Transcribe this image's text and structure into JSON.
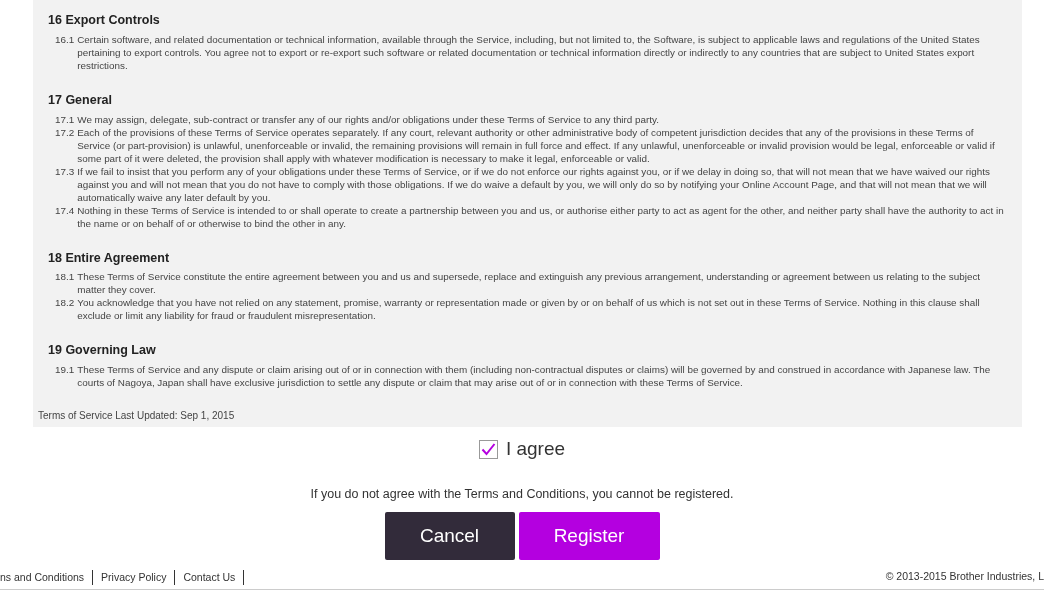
{
  "sections": [
    {
      "heading": "16 Export Controls",
      "clauses": [
        {
          "number": "16.1",
          "text": "Certain software, and related documentation or technical information, available through the Service, including, but not limited to, the Software, is subject to applicable laws and regulations of the United States pertaining to export controls. You agree not to export or re-export such software or related documentation or technical information directly or indirectly to any countries that are subject to United States export restrictions."
        }
      ]
    },
    {
      "heading": "17 General",
      "clauses": [
        {
          "number": "17.1",
          "text": "We may assign, delegate, sub-contract or transfer any of our rights and/or obligations under these Terms of Service to any third party."
        },
        {
          "number": "17.2",
          "text": "Each of the provisions of these Terms of Service operates separately. If any court, relevant authority or other administrative body of competent jurisdiction decides that any of the provisions in these Terms of Service (or part-provision) is unlawful, unenforceable or invalid, the remaining provisions will remain in full force and effect. If any unlawful, unenforceable or invalid provision would be legal, enforceable or valid if some part of it were deleted, the provision shall apply with whatever modification is necessary to make it legal, enforceable or valid."
        },
        {
          "number": "17.3",
          "text": "If we fail to insist that you perform any of your obligations under these Terms of Service, or if we do not enforce our rights against you, or if we delay in doing so, that will not mean that we have waived our rights against you and will not mean that you do not have to comply with those obligations. If we do waive a default by you, we will only do so by notifying your Online Account Page, and that will not mean that we will automatically waive any later default by you."
        },
        {
          "number": "17.4",
          "text": "Nothing in these Terms of Service is intended to or shall operate to create a partnership between you and us, or authorise either party to act as agent for the other, and neither party shall have the authority to act in the name or on behalf of or otherwise to bind the other in any."
        }
      ]
    },
    {
      "heading": "18 Entire Agreement",
      "clauses": [
        {
          "number": "18.1",
          "text": "These Terms of Service constitute the entire agreement between you and us and supersede, replace and extinguish any previous arrangement, understanding or agreement between us relating to the subject matter they cover."
        },
        {
          "number": "18.2",
          "text": "You acknowledge that you have not relied on any statement, promise, warranty or representation made or given by or on behalf of us which is not set out in these Terms of Service. Nothing in this clause shall exclude or limit any liability for fraud or fraudulent misrepresentation."
        }
      ]
    },
    {
      "heading": "19 Governing Law",
      "clauses": [
        {
          "number": "19.1",
          "text": "These Terms of Service and any dispute or claim arising out of or in connection with them (including non-contractual disputes or claims) will be governed by and construed in accordance with Japanese law. The courts of Nagoya, Japan shall have exclusive jurisdiction to settle any dispute or claim that may arise out of or in connection with these Terms of Service."
        }
      ]
    }
  ],
  "last_updated": "Terms of Service Last Updated: Sep 1, 2015",
  "agree": {
    "label": "I agree",
    "checked": true
  },
  "notice": "If you do not agree with the Terms and Conditions, you cannot be registered.",
  "buttons": [
    {
      "label": "Cancel",
      "kind": "secondary"
    },
    {
      "label": "Register",
      "kind": "primary"
    }
  ],
  "footer": {
    "links": [
      "ns and Conditions",
      "Privacy Policy",
      "Contact Us"
    ],
    "copyright": "© 2013-2015 Brother Industries, L"
  }
}
